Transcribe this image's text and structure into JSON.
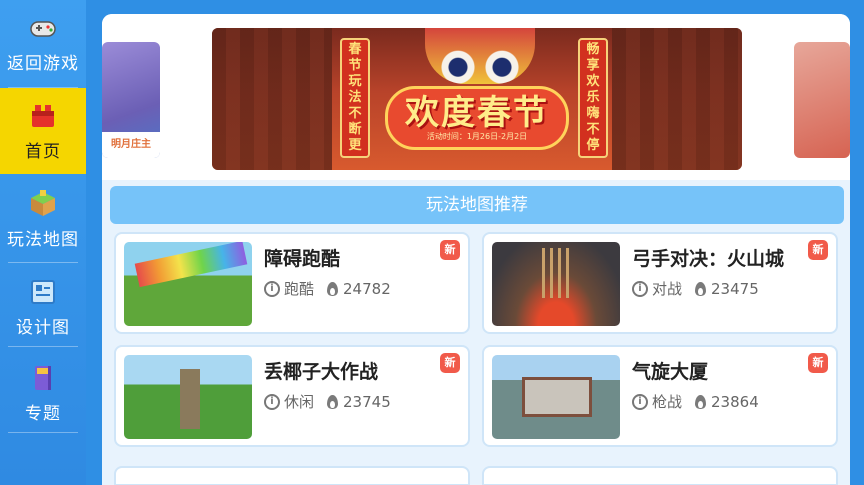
{
  "sidebar": {
    "items": [
      {
        "label": "返回游戏",
        "icon": "gamepad-icon"
      },
      {
        "label": "首页",
        "icon": "home-icon"
      },
      {
        "label": "玩法地图",
        "icon": "map-blocks-icon"
      },
      {
        "label": "设计图",
        "icon": "blueprint-book-icon"
      },
      {
        "label": "专题",
        "icon": "topic-book-icon"
      }
    ],
    "active_index": 1
  },
  "banner": {
    "left_card_caption": "明月庄主",
    "left_pill": "春节玩法不断更",
    "right_pill": "畅享欢乐嗨不停",
    "title": "欢度春节",
    "date": "活动时间：1月26日-2月2日"
  },
  "section": {
    "title": "玩法地图推荐"
  },
  "maps": [
    {
      "name": "障碍跑酷",
      "category": "跑酷",
      "heat": "24782",
      "badge": "新"
    },
    {
      "name": "弓手对决：火山城",
      "category": "对战",
      "heat": "23475",
      "badge": "新"
    },
    {
      "name": "丢椰子大作战",
      "category": "休闲",
      "heat": "23745",
      "badge": "新"
    },
    {
      "name": "气旋大厦",
      "category": "枪战",
      "heat": "23864",
      "badge": "新"
    }
  ],
  "colors": {
    "accent_blue": "#2f8fe4",
    "active_yellow": "#f5d600",
    "badge_red": "#f15a4a",
    "section_bar": "#76c3f9"
  }
}
